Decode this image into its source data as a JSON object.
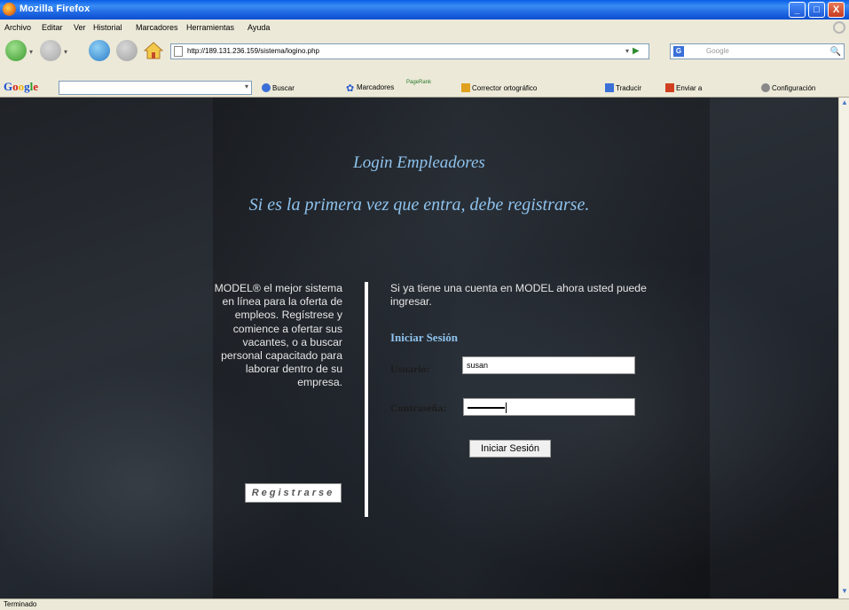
{
  "window": {
    "title": "Mozilla Firefox",
    "controls": {
      "minimize": "_",
      "maximize": "□",
      "close": "X"
    }
  },
  "menu": [
    "Archivo",
    "Editar",
    "Ver",
    "Historial",
    "Marcadores",
    "Herramientas",
    "Ayuda"
  ],
  "nav": {
    "url": "http://189.131.236.159/sistema/logino.php",
    "search_placeholder": "Google",
    "go_arrow": "▶",
    "dropdown": "▾",
    "search_icon": "🔍"
  },
  "google_toolbar": {
    "logo": {
      "g1": "G",
      "o1": "o",
      "o2": "o",
      "g2": "g",
      "l": "l",
      "e": "e"
    },
    "buttons": [
      "Buscar",
      "Marcadores",
      "PageRank",
      "Corrector ortográfico",
      "Traducir",
      "Enviar a",
      "Configuración"
    ]
  },
  "page": {
    "title": "Login Empleadores",
    "subtitle": "Si es la primera vez que entra, debe registrarse.",
    "promo": "MODEL® el mejor sistema en línea para la oferta de empleos. Regístrese y comience a ofertar sus vacantes, o a buscar personal capacitado para laborar dentro de su empresa.",
    "register_button": "Registrarse",
    "intro": "Si ya tiene una cuenta en MODEL ahora usted puede ingresar.",
    "section_title": "Iniciar Sesión",
    "user_label": "Usuario:",
    "user_value": "susan",
    "password_label": "Contraseña:",
    "login_button": "Iniciar Sesión"
  },
  "status": "Terminado",
  "colors": {
    "heading": "#8ec3ee",
    "titlebar": "#1c64e0"
  }
}
